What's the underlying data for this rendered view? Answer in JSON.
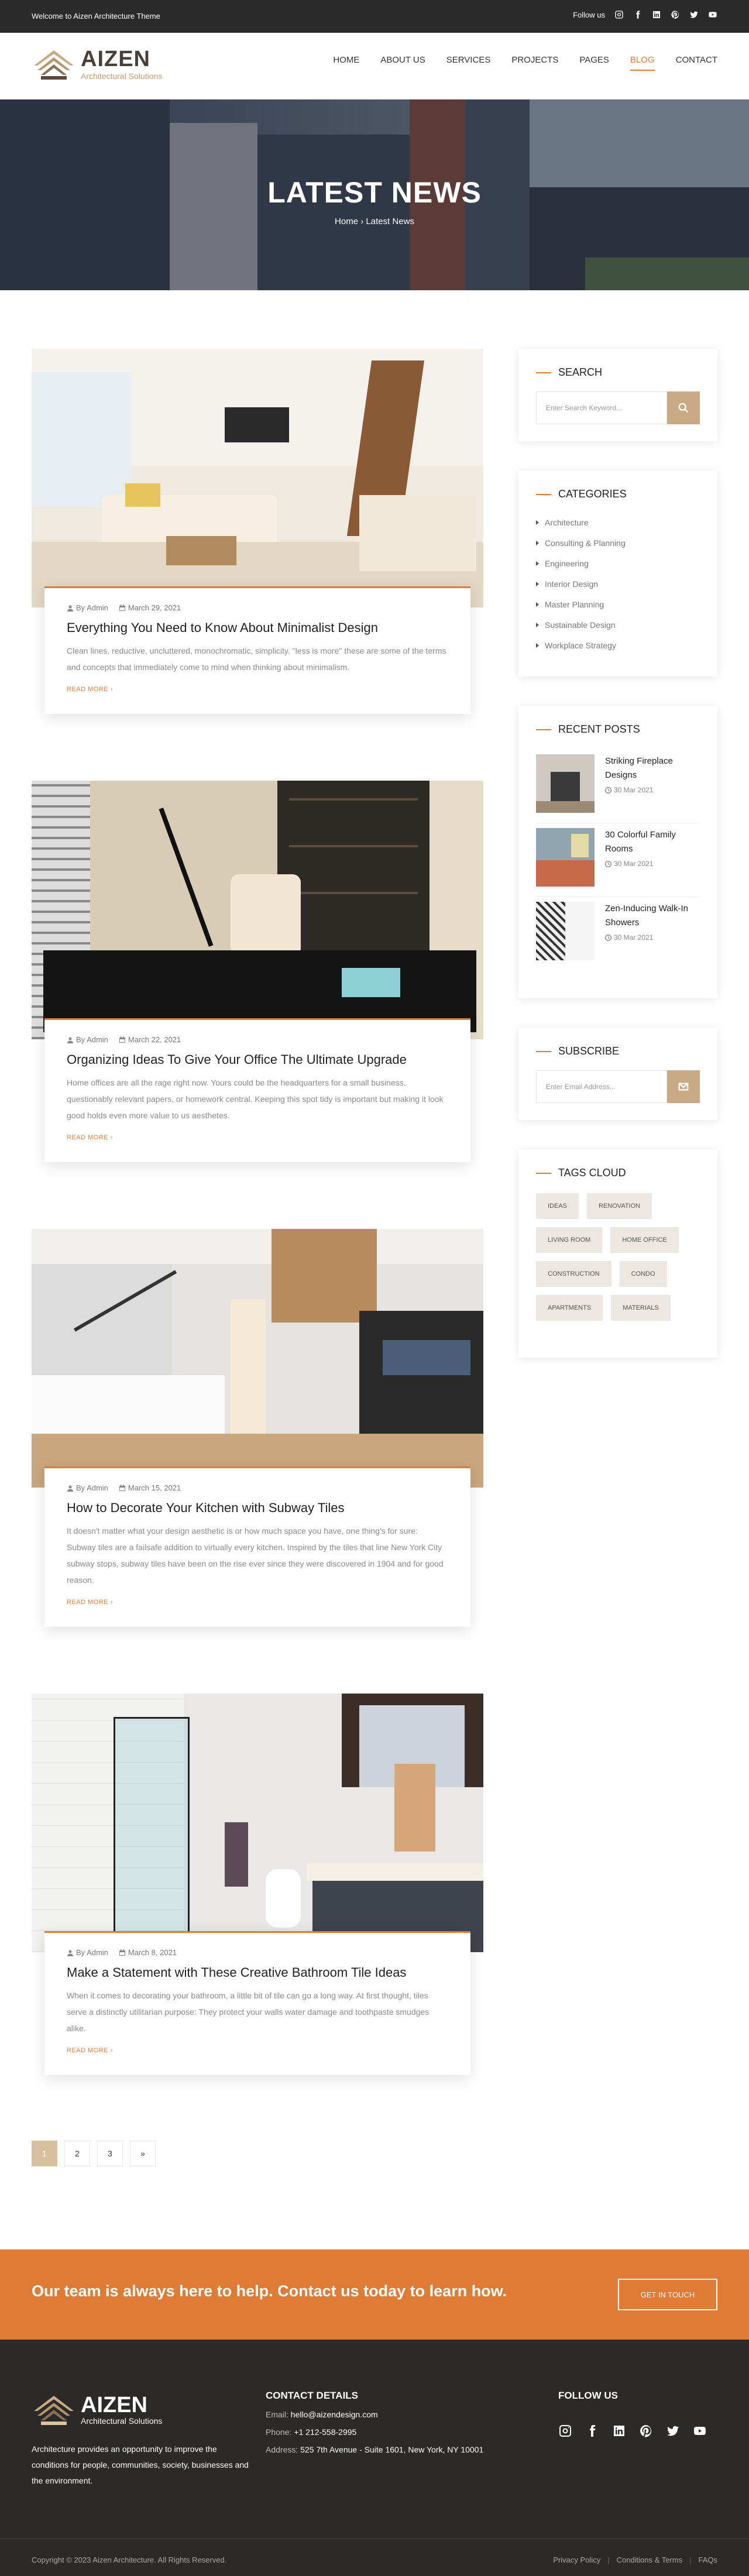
{
  "topbar": {
    "welcome": "Welcome to Aizen Architecture Theme",
    "follow_label": "Follow us",
    "icons": [
      "instagram-icon",
      "facebook-icon",
      "linkedin-icon",
      "pinterest-icon",
      "twitter-icon",
      "youtube-icon"
    ]
  },
  "logo": {
    "brand": "AIZEN",
    "tagline": "Architectural Solutions"
  },
  "nav": {
    "items": [
      {
        "label": "HOME"
      },
      {
        "label": "ABOUT US"
      },
      {
        "label": "SERVICES"
      },
      {
        "label": "PROJECTS"
      },
      {
        "label": "PAGES"
      },
      {
        "label": "BLOG",
        "active": true
      },
      {
        "label": "CONTACT"
      }
    ]
  },
  "hero": {
    "title": "LATEST NEWS",
    "crumb_home": "Home",
    "crumb_current": "Latest News"
  },
  "posts": [
    {
      "author": "By Admin",
      "date": "March 29, 2021",
      "title": "Everything You Need to Know About Minimalist Design",
      "excerpt": "Clean lines, reductive, uncluttered, monochromatic, simplicity. \"less is more\" these are some of the terms and concepts that immediately come to mind when thinking about minimalism.",
      "more": "READ MORE"
    },
    {
      "author": "By Admin",
      "date": "March 22, 2021",
      "title": "Organizing Ideas To Give Your Office The Ultimate Upgrade",
      "excerpt": "Home offices are all the rage right now. Yours could be the headquarters for a small business, questionably relevant papers, or homework central. Keeping this spot tidy is important but making it look good holds even more value to us aesthetes.",
      "more": "READ MORE"
    },
    {
      "author": "By Admin",
      "date": "March 15, 2021",
      "title": "How to Decorate Your Kitchen with Subway Tiles",
      "excerpt": "It doesn't matter what your design aesthetic is or how much space you have, one thing's for sure: Subway tiles are a failsafe addition to virtually every kitchen. Inspired by the tiles that line New York City subway stops, subway tiles have been on the rise ever since they were discovered in 1904 and for good reason.",
      "more": "READ MORE"
    },
    {
      "author": "By Admin",
      "date": "March 8, 2021",
      "title": "Make a Statement with These Creative Bathroom Tile Ideas",
      "excerpt": "When it comes to decorating your bathroom, a little bit of tile can go a long way. At first thought, tiles serve a distinctly utilitarian purpose: They protect your walls water damage and toothpaste smudges alike.",
      "more": "READ MORE"
    }
  ],
  "pagination": {
    "pages": [
      "1",
      "2",
      "3",
      "»"
    ],
    "current": "1"
  },
  "sidebar": {
    "search": {
      "title": "SEARCH",
      "placeholder": "Enter Search Keyword..."
    },
    "categories": {
      "title": "CATEGORIES",
      "items": [
        "Architecture",
        "Consulting & Planning",
        "Engineering",
        "Interior Design",
        "Master Planning",
        "Sustainable Design",
        "Workplace Strategy"
      ]
    },
    "recent": {
      "title": "RECENT POSTS",
      "items": [
        {
          "title": "Striking Fireplace Designs",
          "date": "30 Mar 2021"
        },
        {
          "title": "30 Colorful Family Rooms",
          "date": "30 Mar 2021"
        },
        {
          "title": "Zen-Inducing Walk-In Showers",
          "date": "30 Mar 2021"
        }
      ]
    },
    "subscribe": {
      "title": "SUBSCRIBE",
      "placeholder": "Enter Email Address..."
    },
    "tags": {
      "title": "TAGS CLOUD",
      "items": [
        "IDEAS",
        "RENOVATION",
        "LIVING ROOM",
        "HOME OFFICE",
        "CONSTRUCTION",
        "CONDO",
        "APARTMENTS",
        "MATERIALS"
      ]
    }
  },
  "cta": {
    "text": "Our team is always here to help. Contact us today to learn how.",
    "button": "GET IN TOUCH"
  },
  "footer": {
    "brand": "AIZEN",
    "tagline": "Architectural Solutions",
    "about": "Architecture provides an opportunity to improve the conditions for people, communities, society, businesses and the environment.",
    "contact_title": "CONTACT DETAILS",
    "email_label": "Email:",
    "email": "hello@aizendesign.com",
    "phone_label": "Phone:",
    "phone": "+1 212-558-2995",
    "address_label": "Address:",
    "address": "525 7th Avenue - Suite 1601, New York, NY 10001",
    "follow_title": "FOLLOW US",
    "copyright": "Copyright © 2023 Aizen Architecture. All Rights Reserved.",
    "links": [
      "Privacy Policy",
      "Conditions & Terms",
      "FAQs"
    ]
  },
  "colors": {
    "accent": "#e07b35",
    "gold": "#c9aa84",
    "dark": "#2b2b2b"
  }
}
